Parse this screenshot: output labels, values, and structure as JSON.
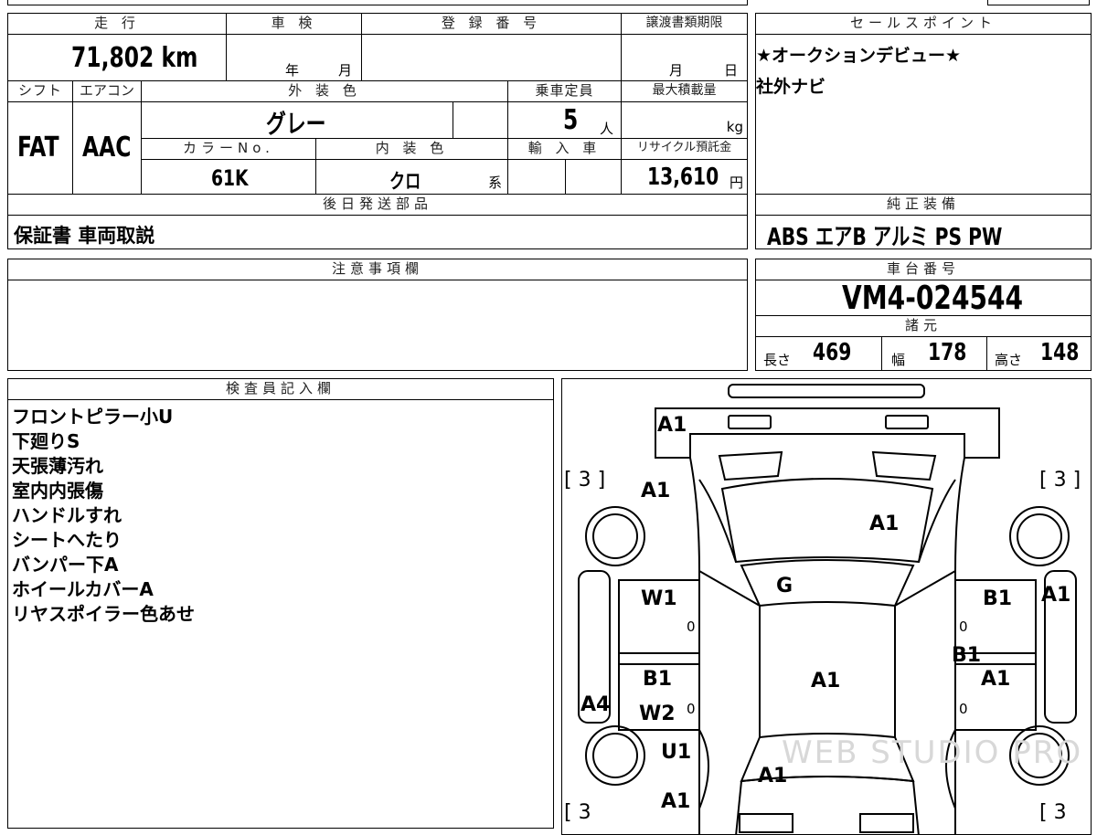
{
  "headers": {
    "mileage": "走 行",
    "inspection": "車 検",
    "registration": "登 録 番 号",
    "transfer_deadline": "譲渡書類期限",
    "sales_point": "セールスポイント",
    "shift": "シフト",
    "aircon": "エアコン",
    "exterior_color": "外 装 色",
    "capacity": "乗車定員",
    "max_load": "最大積載量",
    "color_no": "カラーNo.",
    "interior_color": "内 装 色",
    "import": "輸 入 車",
    "recycle_fee": "リサイクル預託金",
    "later_parts": "後日発送部品",
    "genuine_equipment": "純正装備",
    "notes": "注意事項欄",
    "chassis_no": "車台番号",
    "specs": "諸元",
    "inspector": "検査員記入欄"
  },
  "values": {
    "mileage": "71,802 km",
    "inspection_year_unit": "年",
    "inspection_month_unit": "月",
    "deadline_month_unit": "月",
    "deadline_day_unit": "日",
    "shift": "FAT",
    "aircon": "AAC",
    "exterior_color": "グレー",
    "capacity": "5",
    "capacity_unit": "人",
    "max_load_unit": "kg",
    "color_no": "61K",
    "interior_color": "クロ",
    "interior_suffix": "系",
    "recycle_fee": "13,610",
    "recycle_unit": "円",
    "later_parts": "保証書 車両取説",
    "genuine_equipment": "ABS エアB アルミ PS PW",
    "chassis_no": "VM4-024544",
    "length_label": "長さ",
    "length": "469",
    "width_label": "幅",
    "width": "178",
    "height_label": "高さ",
    "height": "148"
  },
  "sales_points": [
    "★オークションデビュー★",
    "社外ナビ"
  ],
  "inspector_notes": [
    "フロントピラー小U",
    "下廻りS",
    "天張薄汚れ",
    "室内内張傷",
    "ハンドルすれ",
    "シートへたり",
    "バンパー下A",
    "ホイールカバーA",
    "リヤスポイラー色あせ"
  ],
  "diagram": {
    "bracket_tl": "[ 3 ]",
    "bracket_tr": "[ 3 ]",
    "bracket_bl": "[ 3",
    "bracket_br": "[ 3",
    "front_bumper": "A1",
    "hood_left": "A1",
    "hood_main": "A1",
    "windshield": "G",
    "front_left_door": "W1",
    "front_right_door": "B1",
    "right_fender": "A1",
    "rear_right_upper": "B1",
    "rear_right_door": "A1",
    "roof": "A1",
    "rear_left_door": "B1",
    "rear_left_lower": "W2",
    "left_side": "A4",
    "rear_quarter": "U1",
    "trunk": "A1",
    "rear_bumper": "A1",
    "zero_fl": "0",
    "zero_fr": "0",
    "zero_rl": "0",
    "zero_rr": "0",
    "watermark": "WEB STUDIO PRO"
  }
}
